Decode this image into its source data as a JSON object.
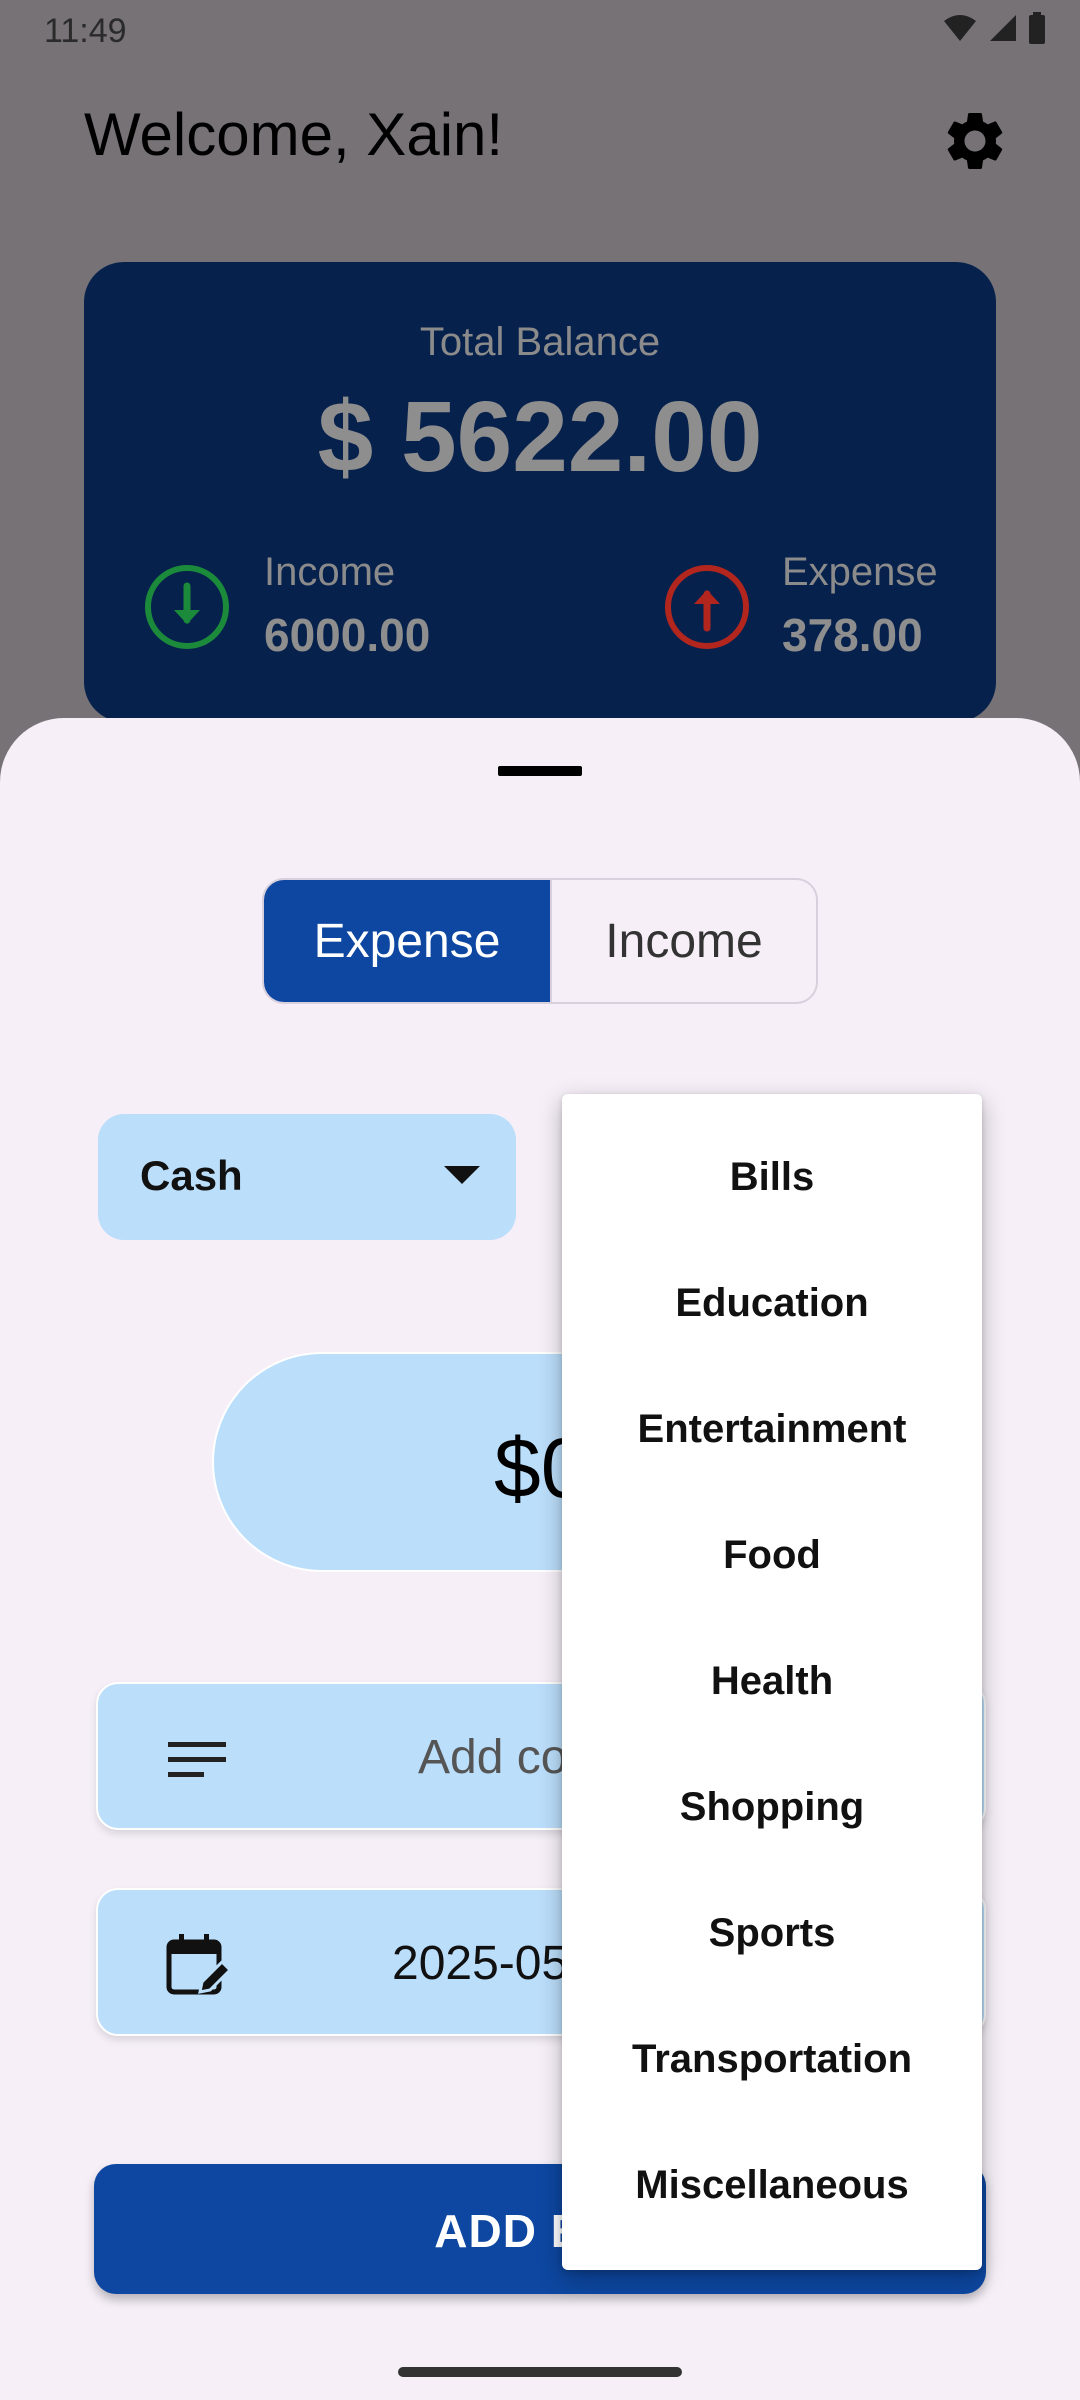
{
  "status_bar": {
    "time": "11:49"
  },
  "header": {
    "welcome": "Welcome, Xain!",
    "settings_icon": "gear-icon"
  },
  "balance_card": {
    "label": "Total Balance",
    "amount": "$ 5622.00",
    "income": {
      "label": "Income",
      "value": "6000.00",
      "icon": "arrow-down-circle-icon",
      "color": "#1b8a3a"
    },
    "expense": {
      "label": "Expense",
      "value": "378.00",
      "icon": "arrow-up-circle-icon",
      "color": "#b3261e"
    }
  },
  "sheet": {
    "toggle": {
      "expense": "Expense",
      "income": "Income",
      "selected": "Expense"
    },
    "wallet": {
      "selected": "Cash"
    },
    "amount": {
      "value": "$0"
    },
    "comment": {
      "placeholder": "Add co"
    },
    "date": {
      "value": "2025-05"
    },
    "add_button": {
      "label": "ADD EXP"
    }
  },
  "category_menu": {
    "items": [
      "Bills",
      "Education",
      "Entertainment",
      "Food",
      "Health",
      "Shopping",
      "Sports",
      "Transportation",
      "Miscellaneous"
    ]
  },
  "colors": {
    "primary": "#0d47a1",
    "field_bg": "#bbdefb",
    "sheet_bg": "#f6eff8",
    "card_bg": "#07214d"
  }
}
